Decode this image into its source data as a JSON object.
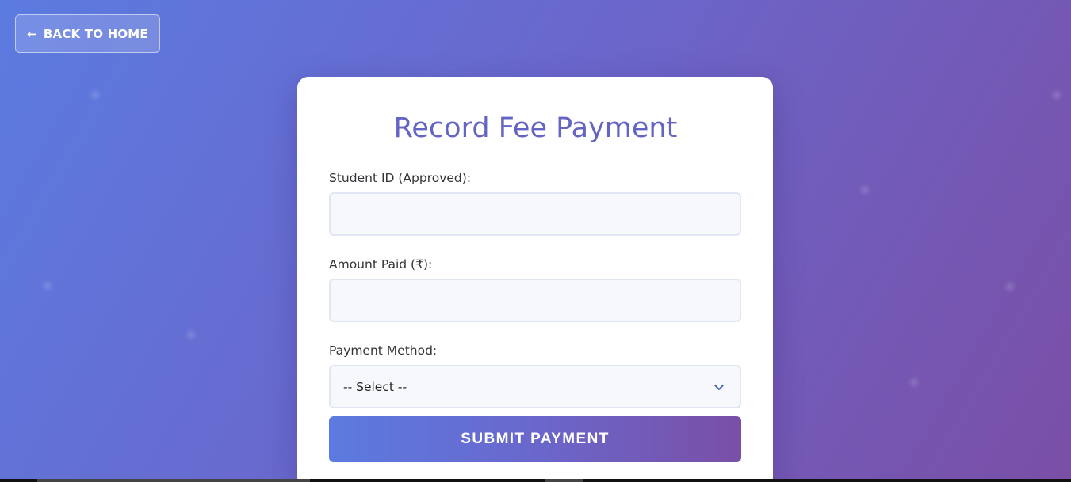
{
  "nav": {
    "back_arrow": "←",
    "back_label": "BACK TO HOME"
  },
  "form": {
    "title": "Record Fee Payment",
    "student_id_label": "Student ID (Approved):",
    "student_id_value": "",
    "amount_label": "Amount Paid (₹):",
    "amount_value": "",
    "method_label": "Payment Method:",
    "method_selected": "-- Select --",
    "submit_label": "SUBMIT PAYMENT"
  },
  "icons": {
    "back": "left-arrow-icon",
    "select": "chevron-down-icon"
  },
  "colors": {
    "gradient_start": "#5b7be0",
    "gradient_end": "#7a4fa6",
    "title": "#6464c4",
    "card": "#ffffff"
  }
}
